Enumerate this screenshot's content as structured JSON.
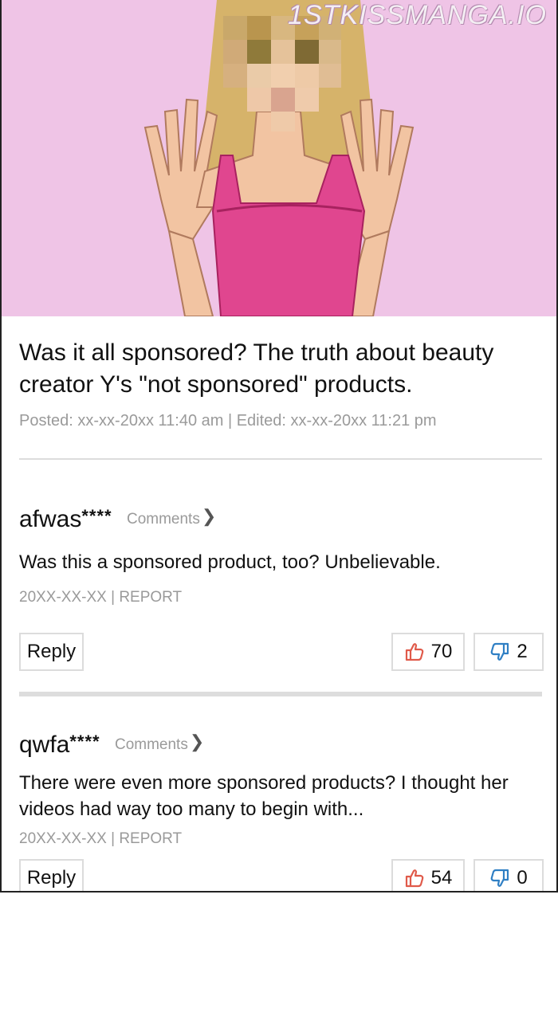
{
  "watermark": "1STKISSMANGA.IO",
  "post": {
    "title": "Was it all sponsored? The truth about beauty creator Y's \"not sponsored\" products.",
    "meta": "Posted: xx-xx-20xx 11:40 am | Edited: xx-xx-20xx 11:21 pm"
  },
  "comments": [
    {
      "user": "afwas",
      "stars": "****",
      "link": "Comments",
      "text": "Was this a sponsored product, too? Unbelievable.",
      "meta": "20XX-XX-XX | REPORT",
      "reply": "Reply",
      "likes": "70",
      "dislikes": "2"
    },
    {
      "user": "qwfa",
      "stars": "****",
      "link": "Comments",
      "text": "There were even more sponsored products? I thought her videos had way too many to begin with...",
      "meta": "20XX-XX-XX | REPORT",
      "reply": "Reply",
      "likes": "54",
      "dislikes": "0"
    }
  ],
  "colors": {
    "background_pink": "#efc4e6",
    "top_magenta": "#e0468f",
    "thumb_up": "#e05a4a",
    "thumb_down": "#2f7fc4",
    "meta_gray": "#9a9a9a"
  },
  "icons": {
    "like": "thumbs-up-icon",
    "dislike": "thumbs-down-icon",
    "chevron": "chevron-right-icon"
  }
}
